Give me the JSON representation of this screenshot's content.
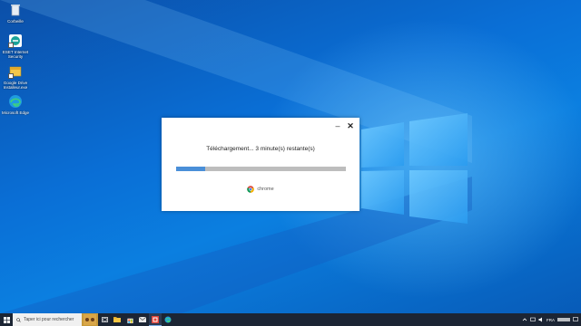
{
  "desktop": {
    "icons": [
      {
        "label": "Corbeille",
        "icon": "recycle-bin-icon"
      },
      {
        "label": "ESET Internet Security",
        "icon": "eset-icon"
      },
      {
        "label": "Google Drive Installeur.exe",
        "icon": "installer-icon"
      },
      {
        "label": "Microsoft Edge",
        "icon": "edge-icon"
      }
    ]
  },
  "dialog": {
    "minimize_label": "–",
    "close_label": "✕",
    "status_text": "Téléchargement... 3 minute(s) restante(s)",
    "progress_fraction": 0.17,
    "brand_name": "chrome"
  },
  "taskbar": {
    "search_placeholder": "Taper ici pour rechercher",
    "apps": [
      "task-view-icon",
      "file-explorer-icon",
      "store-icon",
      "mail-icon",
      "chrome-installer-icon",
      "edge-taskbar-icon"
    ],
    "language": "FRA"
  },
  "colors": {
    "accent": "#4a8fd8",
    "taskbar": "#1c2534",
    "wallpaper": "#0a6fd6"
  }
}
